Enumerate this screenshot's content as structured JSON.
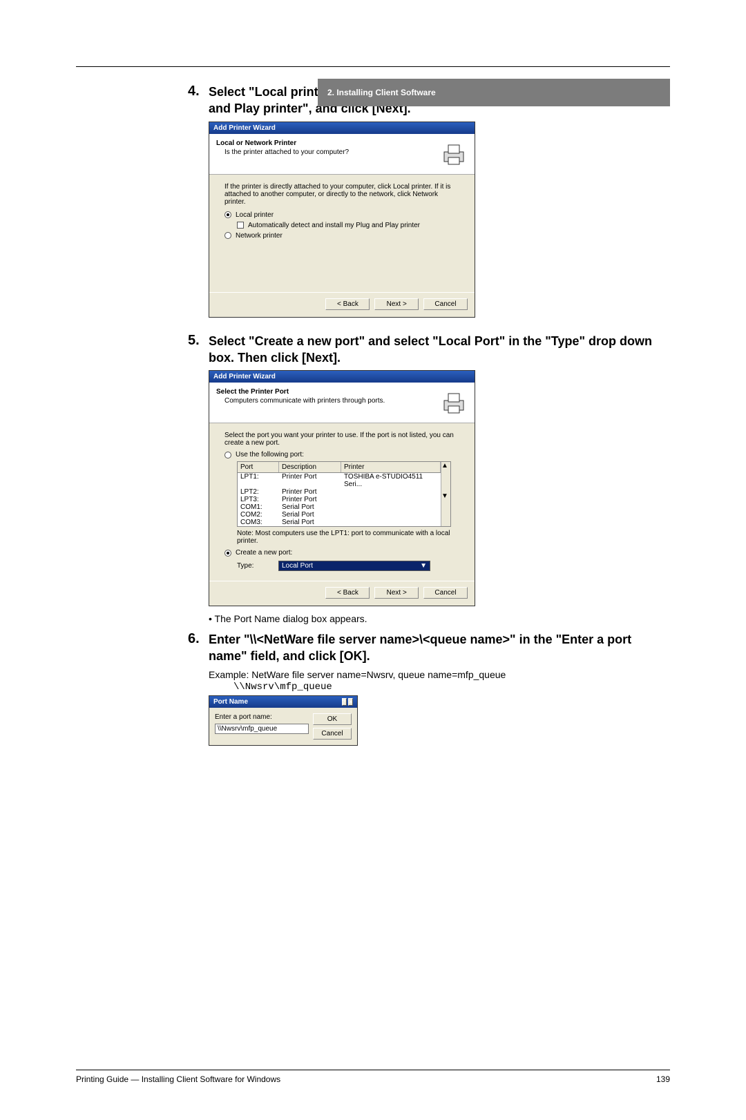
{
  "header": {
    "section": "2. Installing Client Software"
  },
  "steps": {
    "s4": {
      "num": "4.",
      "text": "Select \"Local printer\", uncheck the \"Automatically detect and install my Plug and Play printer\", and click [Next]."
    },
    "s5": {
      "num": "5.",
      "text": "Select \"Create a new port\" and select \"Local Port\" in the \"Type\" drop down box.  Then click [Next].",
      "bullet": "The Port Name dialog box appears."
    },
    "s6": {
      "num": "6.",
      "text": "Enter \"\\\\<NetWare file server name>\\<queue name>\" in the \"Enter a port name\" field, and click [OK].",
      "example": "Example: NetWare file server name=Nwsrv, queue name=mfp_queue",
      "mono": "\\\\Nwsrv\\mfp_queue"
    }
  },
  "wizard1": {
    "title": "Add Printer Wizard",
    "heading": "Local or Network Printer",
    "sub": "Is the printer attached to your computer?",
    "desc": "If the printer is directly attached to your computer, click Local printer. If it is attached to another computer, or directly to the network, click Network printer.",
    "opt_local": "Local printer",
    "opt_auto": "Automatically detect and install my Plug and Play printer",
    "opt_net": "Network printer",
    "back": "< Back",
    "next": "Next >",
    "cancel": "Cancel"
  },
  "wizard2": {
    "title": "Add Printer Wizard",
    "heading": "Select the Printer Port",
    "sub": "Computers communicate with printers through ports.",
    "desc": "Select the port you want your printer to use. If the port is not listed, you can create a new port.",
    "opt_use": "Use the following port:",
    "cols": {
      "port": "Port",
      "desc": "Description",
      "printer": "Printer"
    },
    "rows": [
      {
        "port": "LPT1:",
        "desc": "Printer Port",
        "printer": "TOSHIBA e-STUDIO4511 Seri..."
      },
      {
        "port": "LPT2:",
        "desc": "Printer Port",
        "printer": ""
      },
      {
        "port": "LPT3:",
        "desc": "Printer Port",
        "printer": ""
      },
      {
        "port": "COM1:",
        "desc": "Serial Port",
        "printer": ""
      },
      {
        "port": "COM2:",
        "desc": "Serial Port",
        "printer": ""
      },
      {
        "port": "COM3:",
        "desc": "Serial Port",
        "printer": ""
      }
    ],
    "note": "Note: Most computers use the LPT1: port to communicate with a local printer.",
    "opt_new": "Create a new port:",
    "type_lbl": "Type:",
    "type_val": "Local Port",
    "back": "< Back",
    "next": "Next >",
    "cancel": "Cancel"
  },
  "portdlg": {
    "title": "Port Name",
    "label": "Enter a port name:",
    "value": "\\\\Nwsrv\\mfp_queue",
    "ok": "OK",
    "cancel": "Cancel"
  },
  "footer": {
    "left": "Printing Guide — Installing Client Software for Windows",
    "right": "139"
  }
}
